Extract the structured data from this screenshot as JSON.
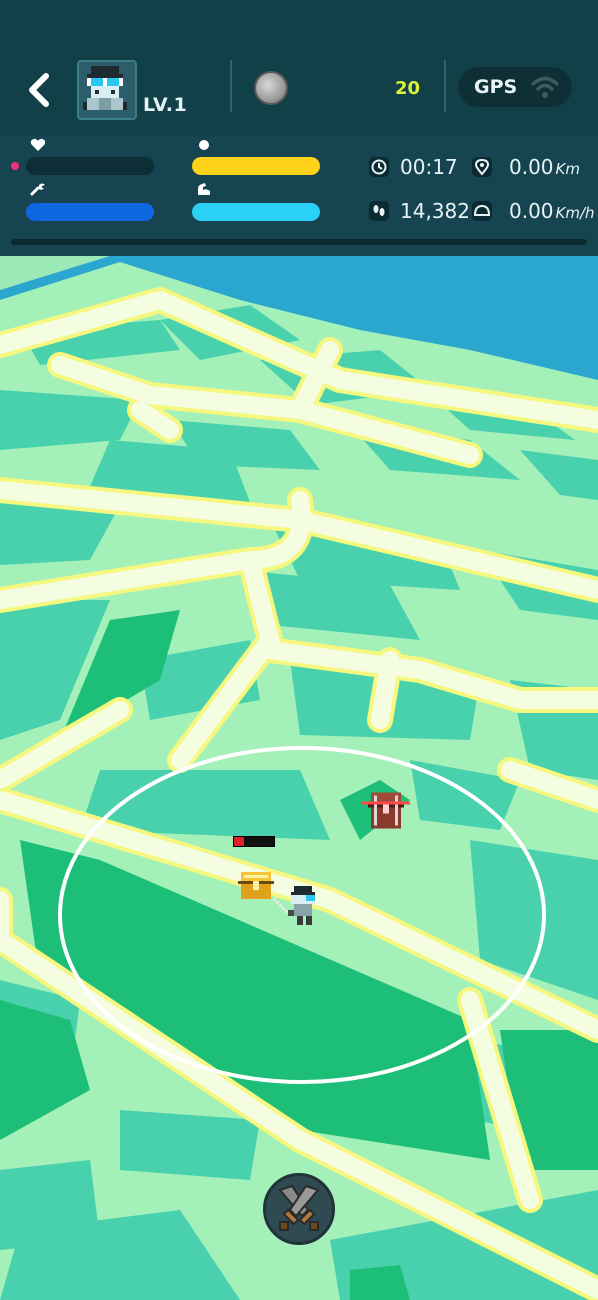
{
  "header": {
    "level": "LV.1",
    "coins": "20",
    "gps_label": "GPS",
    "icons": {
      "back": "chevron-left-icon",
      "coin": "coin-icon",
      "gps": "wifi-signal-icon"
    }
  },
  "stats": {
    "health": {
      "icon": "heart-icon",
      "fill": 0,
      "color": "#ff3c82"
    },
    "stamina": {
      "icon": "dot-icon",
      "fill": 1,
      "color": "#ffd21a"
    },
    "durability": {
      "icon": "wrench-icon",
      "fill": 1,
      "color": "#0f67e0"
    },
    "strength": {
      "icon": "arm-icon",
      "fill": 1,
      "color": "#2ad0f5"
    }
  },
  "info": {
    "time": "00:17",
    "distance_value": "0.00",
    "distance_unit": "Km",
    "steps": "14,382",
    "speed_value": "0.00",
    "speed_unit": "Km/h",
    "icons": {
      "time": "clock-icon",
      "distance": "location-pin-icon",
      "steps": "footsteps-icon",
      "speed": "speedometer-icon"
    }
  },
  "progress": 0,
  "map": {
    "colors": {
      "water": "#2ba6cf",
      "ground": "#a3f0b9",
      "block": "#49d1ae",
      "park": "#1dbf78",
      "road": "#f4fde0",
      "road_edge": "#f5f77e",
      "range_ring": "#ffffff"
    },
    "player_hp": 0.25,
    "icons": {
      "player": "knight-character-icon",
      "chest_gold": "gold-chest-icon",
      "chest_red": "locked-chest-icon",
      "attack": "crossed-swords-icon"
    }
  }
}
